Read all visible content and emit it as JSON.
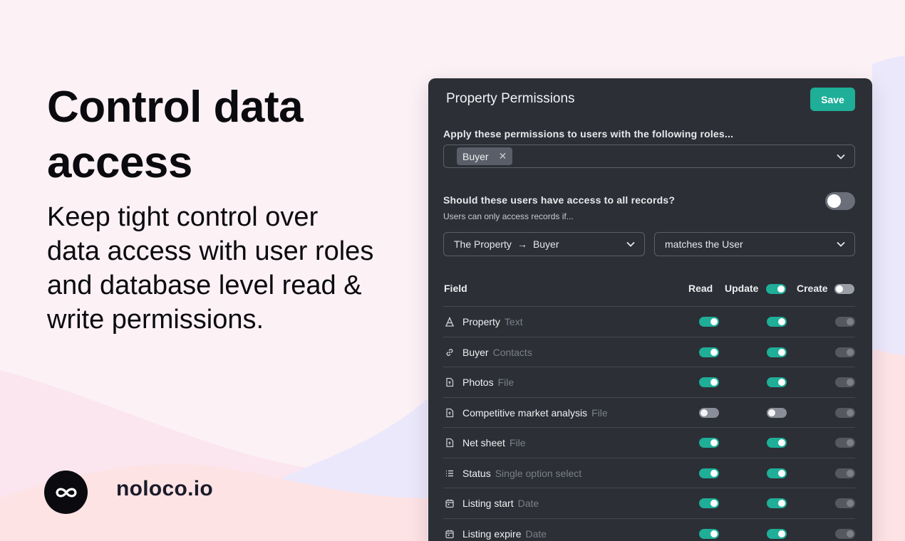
{
  "hero": {
    "title": "Control data access",
    "subtitle": "Keep tight control over data access with user roles and database level read & write permissions."
  },
  "brand": {
    "name": "noloco.io",
    "logo_icon": "infinity-icon"
  },
  "panel": {
    "title": "Property Permissions",
    "save_label": "Save",
    "roles_label": "Apply these permissions to users with the following roles...",
    "roles": [
      "Buyer"
    ],
    "access_question": "Should these users have access to all records?",
    "access_note": "Users can only access records if...",
    "access_all": false,
    "condition": {
      "path_from": "The Property",
      "path_to": "Buyer",
      "operator": "matches the User"
    },
    "columns": {
      "field": "Field",
      "read": "Read",
      "update": "Update",
      "create": "Create"
    },
    "column_toggles": {
      "update": true,
      "create": false
    },
    "fields": [
      {
        "name": "Property",
        "type": "Text",
        "icon": "text-type-icon",
        "read": true,
        "update": true,
        "create": false
      },
      {
        "name": "Buyer",
        "type": "Contacts",
        "icon": "link-icon",
        "read": true,
        "update": true,
        "create": false
      },
      {
        "name": "Photos",
        "type": "File",
        "icon": "file-icon",
        "read": true,
        "update": true,
        "create": false
      },
      {
        "name": "Competitive market analysis",
        "type": "File",
        "icon": "file-icon",
        "read": false,
        "update": false,
        "create": false
      },
      {
        "name": "Net sheet",
        "type": "File",
        "icon": "file-icon",
        "read": true,
        "update": true,
        "create": false
      },
      {
        "name": "Status",
        "type": "Single option select",
        "icon": "list-icon",
        "read": true,
        "update": true,
        "create": false
      },
      {
        "name": "Listing start",
        "type": "Date",
        "icon": "calendar-icon",
        "read": true,
        "update": true,
        "create": false
      },
      {
        "name": "Listing expire",
        "type": "Date",
        "icon": "calendar-icon",
        "read": true,
        "update": true,
        "create": false
      }
    ],
    "colors": {
      "accent": "#1fae98",
      "panel_bg": "#2c2f36"
    }
  }
}
